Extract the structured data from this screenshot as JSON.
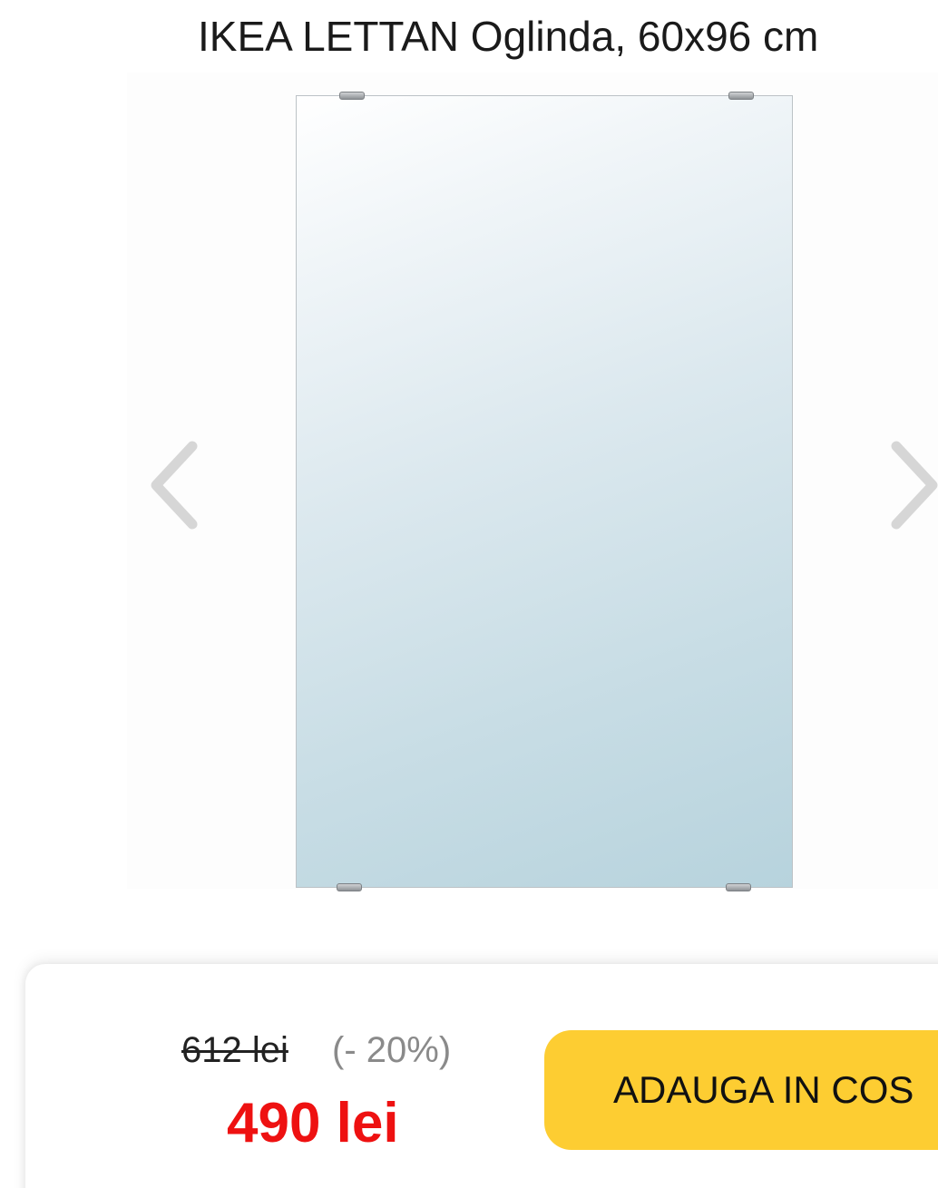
{
  "product": {
    "title": "IKEA LETTAN Oglinda, 60x96 cm"
  },
  "gallery": {
    "prev_icon": "chevron-left-icon",
    "next_icon": "chevron-right-icon"
  },
  "pricing": {
    "old_price": "612 lei",
    "discount": "(- 20%)",
    "new_price": "490 lei",
    "new_price_color": "#ee1111"
  },
  "cart": {
    "add_label": "ADAUGA IN COS",
    "button_color": "#fdcd32"
  }
}
